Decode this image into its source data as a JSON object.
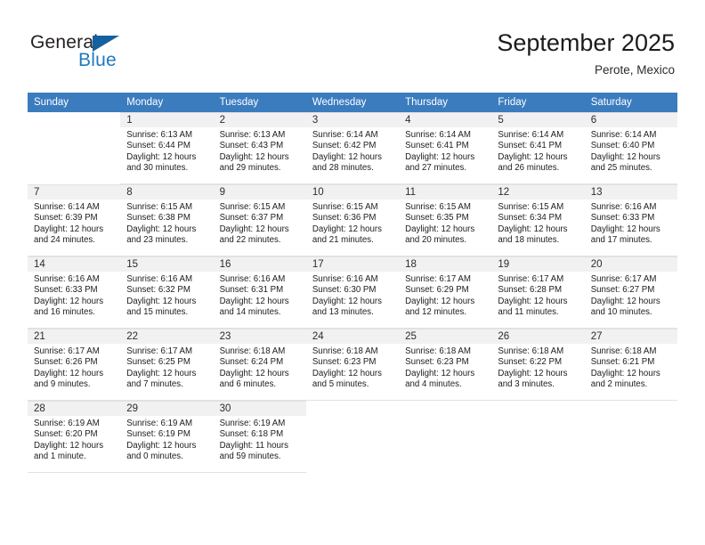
{
  "brand": {
    "name_part1": "General",
    "name_part2": "Blue",
    "triangle_color": "#1461a0",
    "blue": "#1f7ac1"
  },
  "header": {
    "title": "September 2025",
    "subtitle": "Perote, Mexico"
  },
  "theme": {
    "header_row_bg": "#3b7cbf",
    "daynum_bg": "#f1f1f1",
    "row_border": "#e2e2e2",
    "text": "#202020"
  },
  "weekday_headers": [
    "Sunday",
    "Monday",
    "Tuesday",
    "Wednesday",
    "Thursday",
    "Friday",
    "Saturday"
  ],
  "weeks": [
    [
      {
        "day": "",
        "lines": []
      },
      {
        "day": "1",
        "lines": [
          "Sunrise: 6:13 AM",
          "Sunset: 6:44 PM",
          "Daylight: 12 hours",
          "and 30 minutes."
        ]
      },
      {
        "day": "2",
        "lines": [
          "Sunrise: 6:13 AM",
          "Sunset: 6:43 PM",
          "Daylight: 12 hours",
          "and 29 minutes."
        ]
      },
      {
        "day": "3",
        "lines": [
          "Sunrise: 6:14 AM",
          "Sunset: 6:42 PM",
          "Daylight: 12 hours",
          "and 28 minutes."
        ]
      },
      {
        "day": "4",
        "lines": [
          "Sunrise: 6:14 AM",
          "Sunset: 6:41 PM",
          "Daylight: 12 hours",
          "and 27 minutes."
        ]
      },
      {
        "day": "5",
        "lines": [
          "Sunrise: 6:14 AM",
          "Sunset: 6:41 PM",
          "Daylight: 12 hours",
          "and 26 minutes."
        ]
      },
      {
        "day": "6",
        "lines": [
          "Sunrise: 6:14 AM",
          "Sunset: 6:40 PM",
          "Daylight: 12 hours",
          "and 25 minutes."
        ]
      }
    ],
    [
      {
        "day": "7",
        "lines": [
          "Sunrise: 6:14 AM",
          "Sunset: 6:39 PM",
          "Daylight: 12 hours",
          "and 24 minutes."
        ]
      },
      {
        "day": "8",
        "lines": [
          "Sunrise: 6:15 AM",
          "Sunset: 6:38 PM",
          "Daylight: 12 hours",
          "and 23 minutes."
        ]
      },
      {
        "day": "9",
        "lines": [
          "Sunrise: 6:15 AM",
          "Sunset: 6:37 PM",
          "Daylight: 12 hours",
          "and 22 minutes."
        ]
      },
      {
        "day": "10",
        "lines": [
          "Sunrise: 6:15 AM",
          "Sunset: 6:36 PM",
          "Daylight: 12 hours",
          "and 21 minutes."
        ]
      },
      {
        "day": "11",
        "lines": [
          "Sunrise: 6:15 AM",
          "Sunset: 6:35 PM",
          "Daylight: 12 hours",
          "and 20 minutes."
        ]
      },
      {
        "day": "12",
        "lines": [
          "Sunrise: 6:15 AM",
          "Sunset: 6:34 PM",
          "Daylight: 12 hours",
          "and 18 minutes."
        ]
      },
      {
        "day": "13",
        "lines": [
          "Sunrise: 6:16 AM",
          "Sunset: 6:33 PM",
          "Daylight: 12 hours",
          "and 17 minutes."
        ]
      }
    ],
    [
      {
        "day": "14",
        "lines": [
          "Sunrise: 6:16 AM",
          "Sunset: 6:33 PM",
          "Daylight: 12 hours",
          "and 16 minutes."
        ]
      },
      {
        "day": "15",
        "lines": [
          "Sunrise: 6:16 AM",
          "Sunset: 6:32 PM",
          "Daylight: 12 hours",
          "and 15 minutes."
        ]
      },
      {
        "day": "16",
        "lines": [
          "Sunrise: 6:16 AM",
          "Sunset: 6:31 PM",
          "Daylight: 12 hours",
          "and 14 minutes."
        ]
      },
      {
        "day": "17",
        "lines": [
          "Sunrise: 6:16 AM",
          "Sunset: 6:30 PM",
          "Daylight: 12 hours",
          "and 13 minutes."
        ]
      },
      {
        "day": "18",
        "lines": [
          "Sunrise: 6:17 AM",
          "Sunset: 6:29 PM",
          "Daylight: 12 hours",
          "and 12 minutes."
        ]
      },
      {
        "day": "19",
        "lines": [
          "Sunrise: 6:17 AM",
          "Sunset: 6:28 PM",
          "Daylight: 12 hours",
          "and 11 minutes."
        ]
      },
      {
        "day": "20",
        "lines": [
          "Sunrise: 6:17 AM",
          "Sunset: 6:27 PM",
          "Daylight: 12 hours",
          "and 10 minutes."
        ]
      }
    ],
    [
      {
        "day": "21",
        "lines": [
          "Sunrise: 6:17 AM",
          "Sunset: 6:26 PM",
          "Daylight: 12 hours",
          "and 9 minutes."
        ]
      },
      {
        "day": "22",
        "lines": [
          "Sunrise: 6:17 AM",
          "Sunset: 6:25 PM",
          "Daylight: 12 hours",
          "and 7 minutes."
        ]
      },
      {
        "day": "23",
        "lines": [
          "Sunrise: 6:18 AM",
          "Sunset: 6:24 PM",
          "Daylight: 12 hours",
          "and 6 minutes."
        ]
      },
      {
        "day": "24",
        "lines": [
          "Sunrise: 6:18 AM",
          "Sunset: 6:23 PM",
          "Daylight: 12 hours",
          "and 5 minutes."
        ]
      },
      {
        "day": "25",
        "lines": [
          "Sunrise: 6:18 AM",
          "Sunset: 6:23 PM",
          "Daylight: 12 hours",
          "and 4 minutes."
        ]
      },
      {
        "day": "26",
        "lines": [
          "Sunrise: 6:18 AM",
          "Sunset: 6:22 PM",
          "Daylight: 12 hours",
          "and 3 minutes."
        ]
      },
      {
        "day": "27",
        "lines": [
          "Sunrise: 6:18 AM",
          "Sunset: 6:21 PM",
          "Daylight: 12 hours",
          "and 2 minutes."
        ]
      }
    ],
    [
      {
        "day": "28",
        "lines": [
          "Sunrise: 6:19 AM",
          "Sunset: 6:20 PM",
          "Daylight: 12 hours",
          "and 1 minute."
        ]
      },
      {
        "day": "29",
        "lines": [
          "Sunrise: 6:19 AM",
          "Sunset: 6:19 PM",
          "Daylight: 12 hours",
          "and 0 minutes."
        ]
      },
      {
        "day": "30",
        "lines": [
          "Sunrise: 6:19 AM",
          "Sunset: 6:18 PM",
          "Daylight: 11 hours",
          "and 59 minutes."
        ]
      },
      {
        "day": "",
        "lines": []
      },
      {
        "day": "",
        "lines": []
      },
      {
        "day": "",
        "lines": []
      },
      {
        "day": "",
        "lines": []
      }
    ]
  ]
}
